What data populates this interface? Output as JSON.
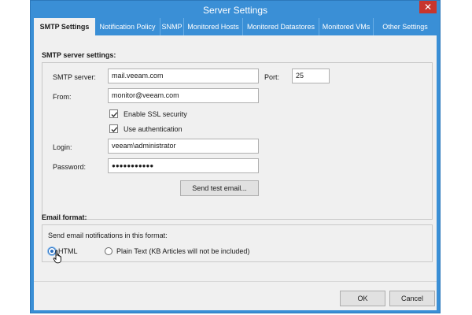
{
  "window": {
    "title": "Server Settings",
    "close_glyph": "✕"
  },
  "tabs": [
    {
      "label": "SMTP Settings",
      "active": true
    },
    {
      "label": "Notification Policy"
    },
    {
      "label": "SNMP"
    },
    {
      "label": "Monitored Hosts"
    },
    {
      "label": "Monitored Datastores"
    },
    {
      "label": "Monitored VMs"
    },
    {
      "label": "Other Settings"
    }
  ],
  "smtp": {
    "section_title": "SMTP server settings:",
    "server_label": "SMTP server:",
    "server_value": "mail.veeam.com",
    "port_label": "Port:",
    "port_value": "25",
    "from_label": "From:",
    "from_value": "monitor@veeam.com",
    "ssl_label": "Enable SSL security",
    "ssl_checked": true,
    "auth_label": "Use authentication",
    "auth_checked": true,
    "login_label": "Login:",
    "login_value": "veeam\\administrator",
    "password_label": "Password:",
    "password_value": "●●●●●●●●●●●",
    "test_button": "Send test email..."
  },
  "email_format": {
    "section_title": "Email format:",
    "prompt": "Send email notifications in this format:",
    "html_label": "HTML",
    "plain_label": "Plain Text (KB Articles will not be included)",
    "selected": "HTML"
  },
  "footer": {
    "ok_label": "OK",
    "cancel_label": "Cancel"
  },
  "colors": {
    "accent": "#3a8fd6",
    "close": "#c7352d",
    "dialog_bg": "#f0f0f0"
  },
  "icons": {
    "close": "close-icon",
    "check": "checkmark-icon",
    "cursor": "hand-pointer-icon"
  }
}
